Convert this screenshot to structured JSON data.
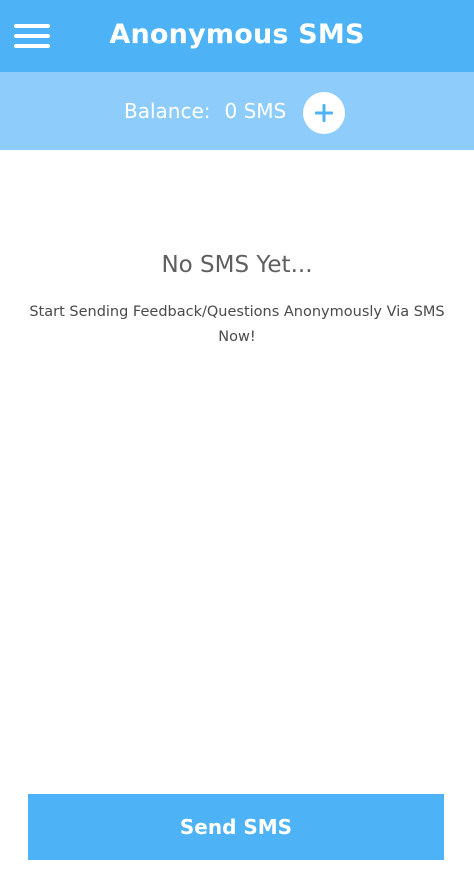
{
  "header": {
    "title": "Anonymous SMS",
    "menu_icon": "hamburger-menu-icon"
  },
  "balance": {
    "label": "Balance:",
    "value": "0 SMS",
    "add_icon": "plus-icon"
  },
  "empty_state": {
    "title": "No SMS Yet...",
    "subtitle": "Start Sending Feedback/Questions Anonymously Via SMS Now!"
  },
  "footer": {
    "send_label": "Send SMS"
  },
  "colors": {
    "primary": "#4db3f6",
    "primary_light": "#8ecdfb",
    "background": "#ffffff"
  }
}
